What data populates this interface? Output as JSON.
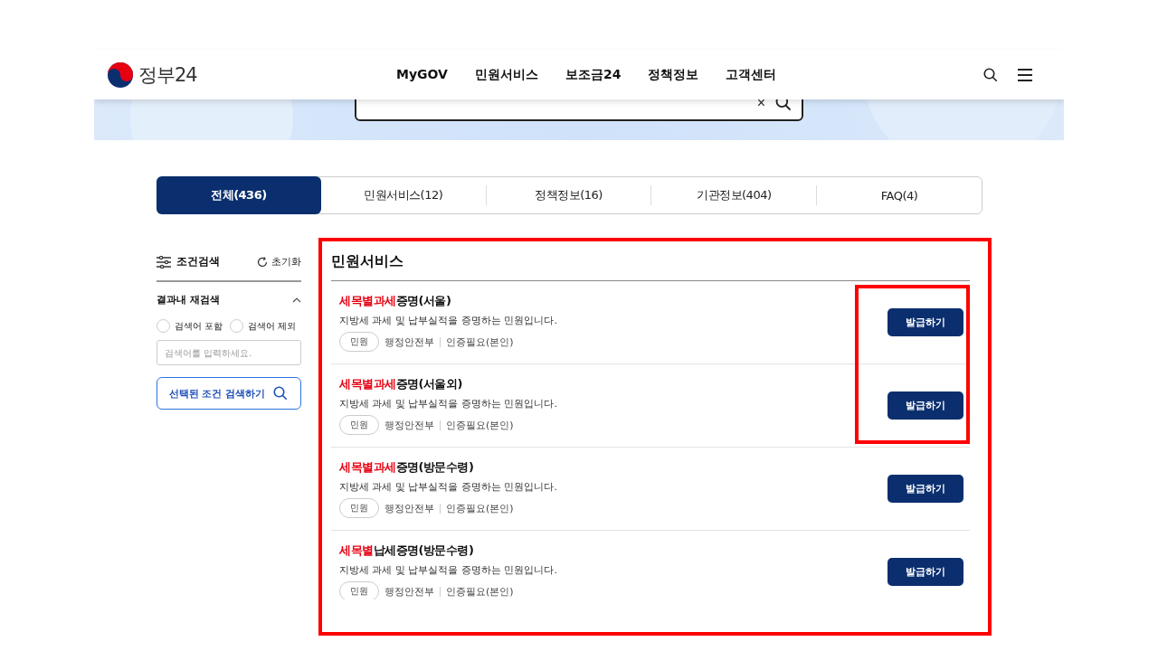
{
  "header": {
    "logo_text": "정부24",
    "nav": [
      "MyGOV",
      "민원서비스",
      "보조금24",
      "정책정보",
      "고객센터"
    ]
  },
  "search": {
    "clear": "×"
  },
  "tabs": [
    {
      "label": "전체(436)",
      "selected": true
    },
    {
      "label": "민원서비스(12)",
      "selected": false
    },
    {
      "label": "정책정보(16)",
      "selected": false
    },
    {
      "label": "기관정보(404)",
      "selected": false
    },
    {
      "label": "FAQ(4)",
      "selected": false
    }
  ],
  "sidebar": {
    "title": "조건검색",
    "reset": "초기화",
    "section": "결과내 재검색",
    "expanded": true,
    "options": [
      {
        "label": "검색어 포함",
        "selected": false
      },
      {
        "label": "검색어 제외",
        "selected": false
      }
    ],
    "placeholder": "검색어를 입력하세요.",
    "submit": "선택된 조건 검색하기"
  },
  "results": {
    "title": "민원서비스",
    "highlighted": true,
    "items": [
      {
        "title_highlight": "세목별과세",
        "title_rest": "증명(서울)",
        "description": "지방세 과세 및 납부실적을 증명하는 민원입니다.",
        "tag": "민원",
        "agency": "행정안전부",
        "auth": "인증필요(본인)",
        "button": "발급하기",
        "highlighted": true
      },
      {
        "title_highlight": "세목별과세",
        "title_rest": "증명(서울외)",
        "description": "지방세 과세 및 납부실적을 증명하는 민원입니다.",
        "tag": "민원",
        "agency": "행정안전부",
        "auth": "인증필요(본인)",
        "button": "발급하기",
        "highlighted": true
      },
      {
        "title_highlight": "세목별과세",
        "title_rest": "증명(방문수령)",
        "description": "지방세 과세 및 납부실적을 증명하는 민원입니다.",
        "tag": "민원",
        "agency": "행정안전부",
        "auth": "인증필요(본인)",
        "button": "발급하기",
        "highlighted": false
      },
      {
        "title_highlight": "세목별",
        "title_rest": "납세증명(방문수령)",
        "description": "지방세 과세 및 납부실적을 증명하는 민원입니다.",
        "tag": "민원",
        "agency": "행정안전부",
        "auth": "인증필요(본인)",
        "button": "발급하기",
        "highlighted": false
      }
    ]
  }
}
